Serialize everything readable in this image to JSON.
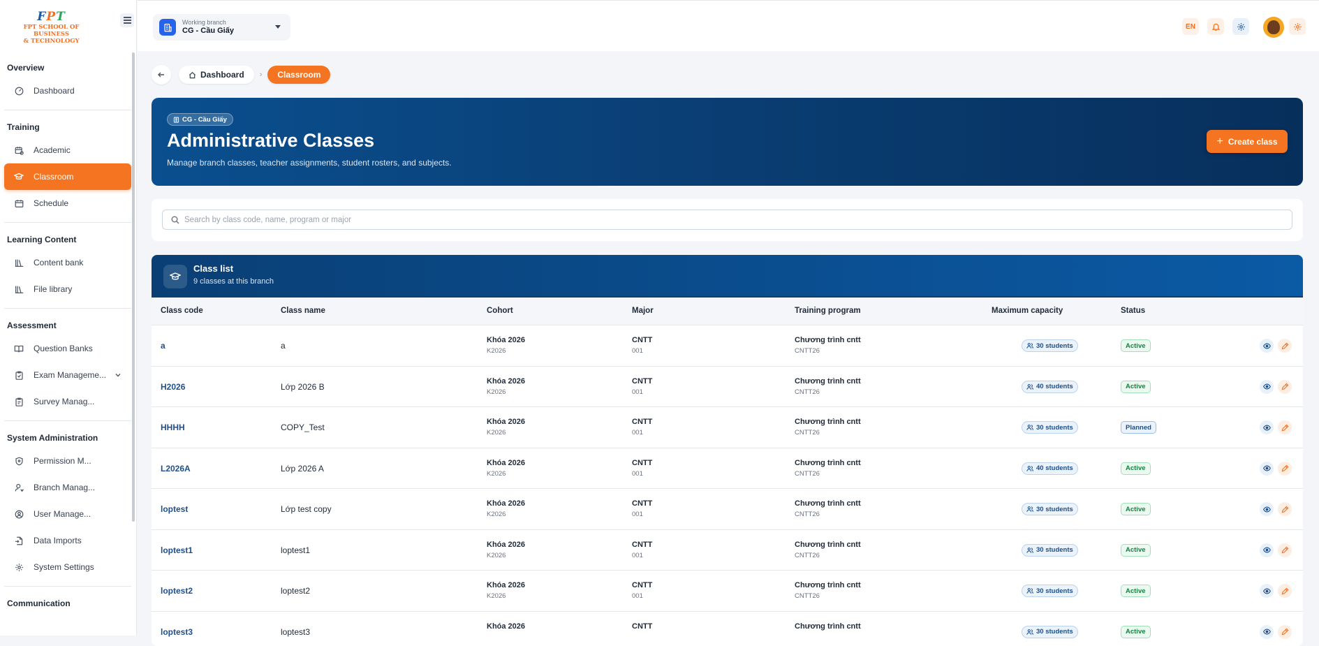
{
  "logo": {
    "fpt": [
      "F",
      "P",
      "T"
    ],
    "line1": "FPT SCHOOL OF BUSINESS",
    "line2": "& TECHNOLOGY"
  },
  "topbar": {
    "branch_label": "Working branch",
    "branch_value": "CG - Cầu Giấy",
    "lang": "EN"
  },
  "sidebar": {
    "sections": [
      {
        "title": "Overview",
        "items": [
          {
            "label": "Dashboard",
            "icon": "gauge-icon"
          }
        ]
      },
      {
        "title": "Training",
        "items": [
          {
            "label": "Academic",
            "icon": "calendar-icon"
          },
          {
            "label": "Classroom",
            "icon": "graduation-cap-icon",
            "active": true
          },
          {
            "label": "Schedule",
            "icon": "calendar-grid-icon"
          }
        ]
      },
      {
        "title": "Learning Content",
        "items": [
          {
            "label": "Content bank",
            "icon": "library-icon"
          },
          {
            "label": "File library",
            "icon": "library-icon"
          }
        ]
      },
      {
        "title": "Assessment",
        "items": [
          {
            "label": "Question Banks",
            "icon": "book-open-icon"
          },
          {
            "label": "Exam Manageme...",
            "icon": "clipboard-icon",
            "expandable": true
          },
          {
            "label": "Survey Manag...",
            "icon": "clipboard-list-icon"
          }
        ]
      },
      {
        "title": "System Administration",
        "items": [
          {
            "label": "Permission M...",
            "icon": "shield-icon"
          },
          {
            "label": "Branch Manag...",
            "icon": "user-pin-icon"
          },
          {
            "label": "User Manage...",
            "icon": "user-circle-icon"
          },
          {
            "label": "Data Imports",
            "icon": "file-import-icon"
          },
          {
            "label": "System Settings",
            "icon": "gear-icon"
          }
        ]
      },
      {
        "title": "Communication",
        "items": []
      }
    ]
  },
  "breadcrumb": {
    "home": "Dashboard",
    "current": "Classroom"
  },
  "hero": {
    "chip": "CG - Cầu Giấy",
    "title": "Administrative Classes",
    "subtitle": "Manage branch classes, teacher assignments, student rosters, and subjects.",
    "create_label": "Create class"
  },
  "search": {
    "placeholder": "Search by class code, name, program or major"
  },
  "table": {
    "title": "Class list",
    "subtitle": "9 classes at this branch",
    "columns": [
      "Class code",
      "Class name",
      "Cohort",
      "Major",
      "Training program",
      "Maximum capacity",
      "Status"
    ],
    "rows": [
      {
        "code": "a",
        "name": "a",
        "cohort": "Khóa 2026",
        "cohort_code": "K2026",
        "major": "CNTT",
        "major_code": "001",
        "program": "Chương trình cntt",
        "program_code": "CNTT26",
        "capacity": "30 students",
        "status": "Active"
      },
      {
        "code": "H2026",
        "name": "Lớp 2026 B",
        "cohort": "Khóa 2026",
        "cohort_code": "K2026",
        "major": "CNTT",
        "major_code": "001",
        "program": "Chương trình cntt",
        "program_code": "CNTT26",
        "capacity": "40 students",
        "status": "Active"
      },
      {
        "code": "HHHH",
        "name": "COPY_Test",
        "cohort": "Khóa 2026",
        "cohort_code": "K2026",
        "major": "CNTT",
        "major_code": "001",
        "program": "Chương trình cntt",
        "program_code": "CNTT26",
        "capacity": "30 students",
        "status": "Planned"
      },
      {
        "code": "L2026A",
        "name": "Lớp 2026 A",
        "cohort": "Khóa 2026",
        "cohort_code": "K2026",
        "major": "CNTT",
        "major_code": "001",
        "program": "Chương trình cntt",
        "program_code": "CNTT26",
        "capacity": "40 students",
        "status": "Active"
      },
      {
        "code": "loptest",
        "name": "Lớp test copy",
        "cohort": "Khóa 2026",
        "cohort_code": "K2026",
        "major": "CNTT",
        "major_code": "001",
        "program": "Chương trình cntt",
        "program_code": "CNTT26",
        "capacity": "30 students",
        "status": "Active"
      },
      {
        "code": "loptest1",
        "name": "loptest1",
        "cohort": "Khóa 2026",
        "cohort_code": "K2026",
        "major": "CNTT",
        "major_code": "001",
        "program": "Chương trình cntt",
        "program_code": "CNTT26",
        "capacity": "30 students",
        "status": "Active"
      },
      {
        "code": "loptest2",
        "name": "loptest2",
        "cohort": "Khóa 2026",
        "cohort_code": "K2026",
        "major": "CNTT",
        "major_code": "001",
        "program": "Chương trình cntt",
        "program_code": "CNTT26",
        "capacity": "30 students",
        "status": "Active"
      },
      {
        "code": "loptest3",
        "name": "loptest3",
        "cohort": "Khóa 2026",
        "cohort_code": "",
        "major": "CNTT",
        "major_code": "",
        "program": "Chương trình cntt",
        "program_code": "",
        "capacity": "30 students",
        "status": "Active"
      }
    ]
  },
  "colors": {
    "accent": "#f47421",
    "navy": "#0a3f75",
    "link": "#1e4f8a"
  }
}
